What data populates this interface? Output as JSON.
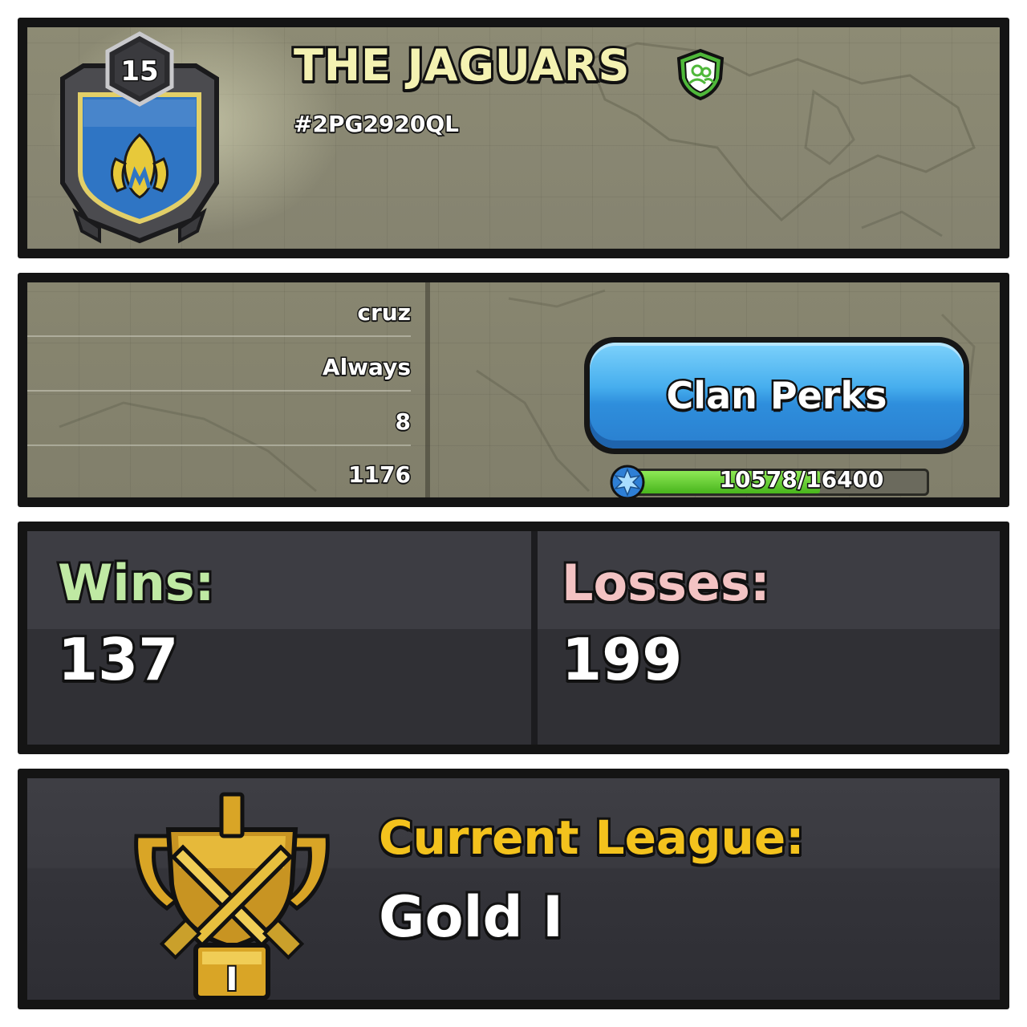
{
  "clan": {
    "level": "15",
    "name": "THE JAGUARS",
    "tag": "#2PG2920QL"
  },
  "info": {
    "rows": [
      "cruz",
      "Always",
      "8",
      "1176"
    ]
  },
  "perks": {
    "button_label": "Clan Perks",
    "xp_text": "10578/16400",
    "xp_current": 10578,
    "xp_max": 16400
  },
  "war": {
    "wins_label": "Wins:",
    "wins_value": "137",
    "losses_label": "Losses:",
    "losses_value": "199"
  },
  "league": {
    "label": "Current League:",
    "value": "Gold I",
    "badge_numeral": "I"
  },
  "colors": {
    "clan_name": "#f4f2b2",
    "wins_label": "#bfe9a3",
    "losses_label": "#f3c3c3",
    "league_label": "#f3c21d",
    "button_blue": "#46aeee",
    "xp_green": "#48b51c",
    "verified_green": "#4fb83a"
  },
  "icons": {
    "verified": "verified-shield-icon",
    "xp": "clan-xp-icon",
    "league": "gold-league-trophy-icon",
    "flame": "flame-icon"
  }
}
